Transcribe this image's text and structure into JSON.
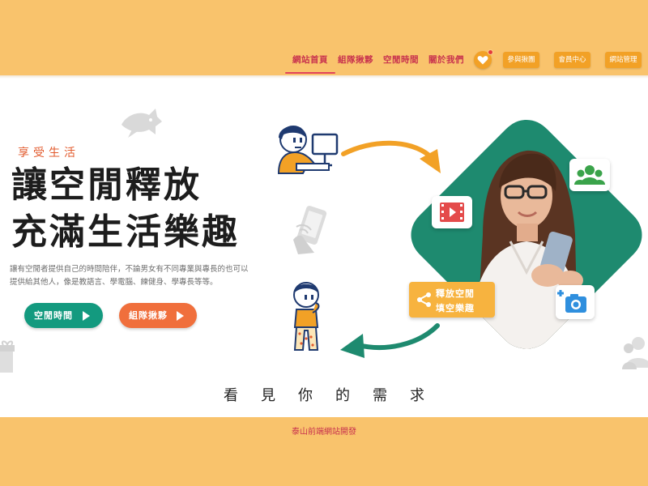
{
  "header": {
    "nav": [
      {
        "label": "網站首頁",
        "active": true
      },
      {
        "label": "組隊揪夥",
        "active": false
      },
      {
        "label": "空閒時間",
        "active": false
      },
      {
        "label": "關於我們",
        "active": false
      }
    ],
    "buttons": {
      "shop": "參與揪團",
      "member": "會員中心",
      "admin": "網站管理"
    }
  },
  "hero": {
    "kicker": "享受生活",
    "title_line1": "讓空閒釋放",
    "title_line2": "充滿生活樂趣",
    "description": "讓有空閒者提供自己的時間陪伴，不論男女有不同專業與專長的也可以提供給其他人，像是教語言、學電腦、練健身、學專長等等。",
    "cta_primary": "空閒時間",
    "cta_secondary": "組隊揪夥",
    "share_line1": "釋放空閒",
    "share_line2": "填空樂趣"
  },
  "section": {
    "title": "看見你的需求"
  },
  "footer": {
    "text": "泰山前端網站開發"
  },
  "colors": {
    "header_bg": "#f9c36c",
    "nav_text": "#c8324e",
    "accent_orange": "#f2a126",
    "green": "#1e8a6f",
    "cta_green": "#139a7f",
    "cta_orange": "#f06f3c"
  }
}
